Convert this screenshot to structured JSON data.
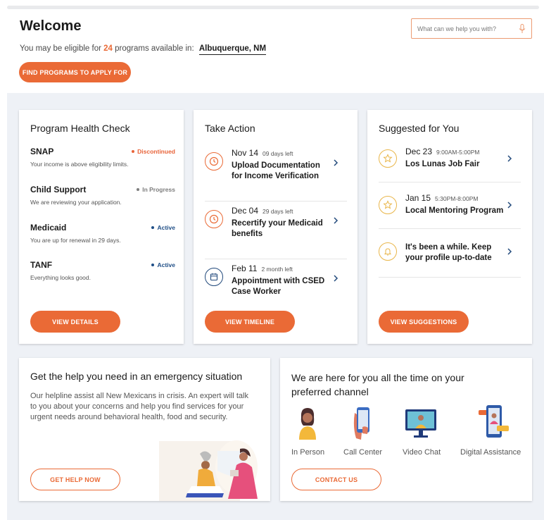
{
  "header": {
    "welcome": "Welcome",
    "eligible_prefix": "You may be eligible for",
    "program_count": "24",
    "eligible_suffix": "programs available in:",
    "location": "Albuquerque, NM",
    "find_button": "FIND PROGRAMS TO APPLY FOR",
    "search_placeholder": "What can we help you with?"
  },
  "health": {
    "title": "Program Health Check",
    "items": [
      {
        "name": "SNAP",
        "status": "Discontinued",
        "status_color": "#e8643a",
        "desc": "Your income is above eligibility limits."
      },
      {
        "name": "Child Support",
        "status": "In Progress",
        "status_color": "#7d7d7d",
        "desc": "We are reviewing your application."
      },
      {
        "name": "Medicaid",
        "status": "Active",
        "status_color": "#1f4e86",
        "desc": "You are up for renewal in 29 days."
      },
      {
        "name": "TANF",
        "status": "Active",
        "status_color": "#1f4e86",
        "desc": "Everything looks good."
      }
    ],
    "button": "VIEW DETAILS"
  },
  "action": {
    "title": "Take Action",
    "items": [
      {
        "date": "Nov 14",
        "sub": "09 days left",
        "title": "Upload Documentation for Income Verification",
        "icon": "clock-icon"
      },
      {
        "date": "Dec 04",
        "sub": "29 days left",
        "title": "Recertify your Medicaid benefits",
        "icon": "clock-icon"
      },
      {
        "date": "Feb 11",
        "sub": "2 month left",
        "title": "Appointment with CSED Case Worker",
        "icon": "calendar-icon"
      }
    ],
    "button": "VIEW TIMELINE"
  },
  "suggested": {
    "title": "Suggested for You",
    "items": [
      {
        "date": "Dec 23",
        "sub": "9:00AM-5:00PM",
        "title": "Los Lunas Job Fair",
        "icon": "star-icon"
      },
      {
        "date": "Jan 15",
        "sub": "5:30PM-8:00PM",
        "title": "Local Mentoring Program",
        "icon": "star-icon"
      },
      {
        "date": "",
        "sub": "",
        "title": "It's been a while. Keep your profile up-to-date",
        "icon": "bell-icon"
      }
    ],
    "button": "VIEW SUGGESTIONS"
  },
  "emergency": {
    "title": "Get the help you need in an emergency situation",
    "text": "Our helpline assist all New Mexicans in crisis. An expert will talk to you about your concerns and help you find services for your urgent needs around behavioral health, food and security.",
    "button": "GET HELP NOW"
  },
  "channels": {
    "title": "We are here for you all the time on your preferred channel",
    "items": [
      "In Person",
      "Call Center",
      "Video Chat",
      "Digital Assistance"
    ],
    "button": "CONTACT US"
  },
  "colors": {
    "accent": "#ea6a36",
    "navy": "#224a7c",
    "gold": "#e9b64a",
    "panel": "#eef1f6"
  }
}
